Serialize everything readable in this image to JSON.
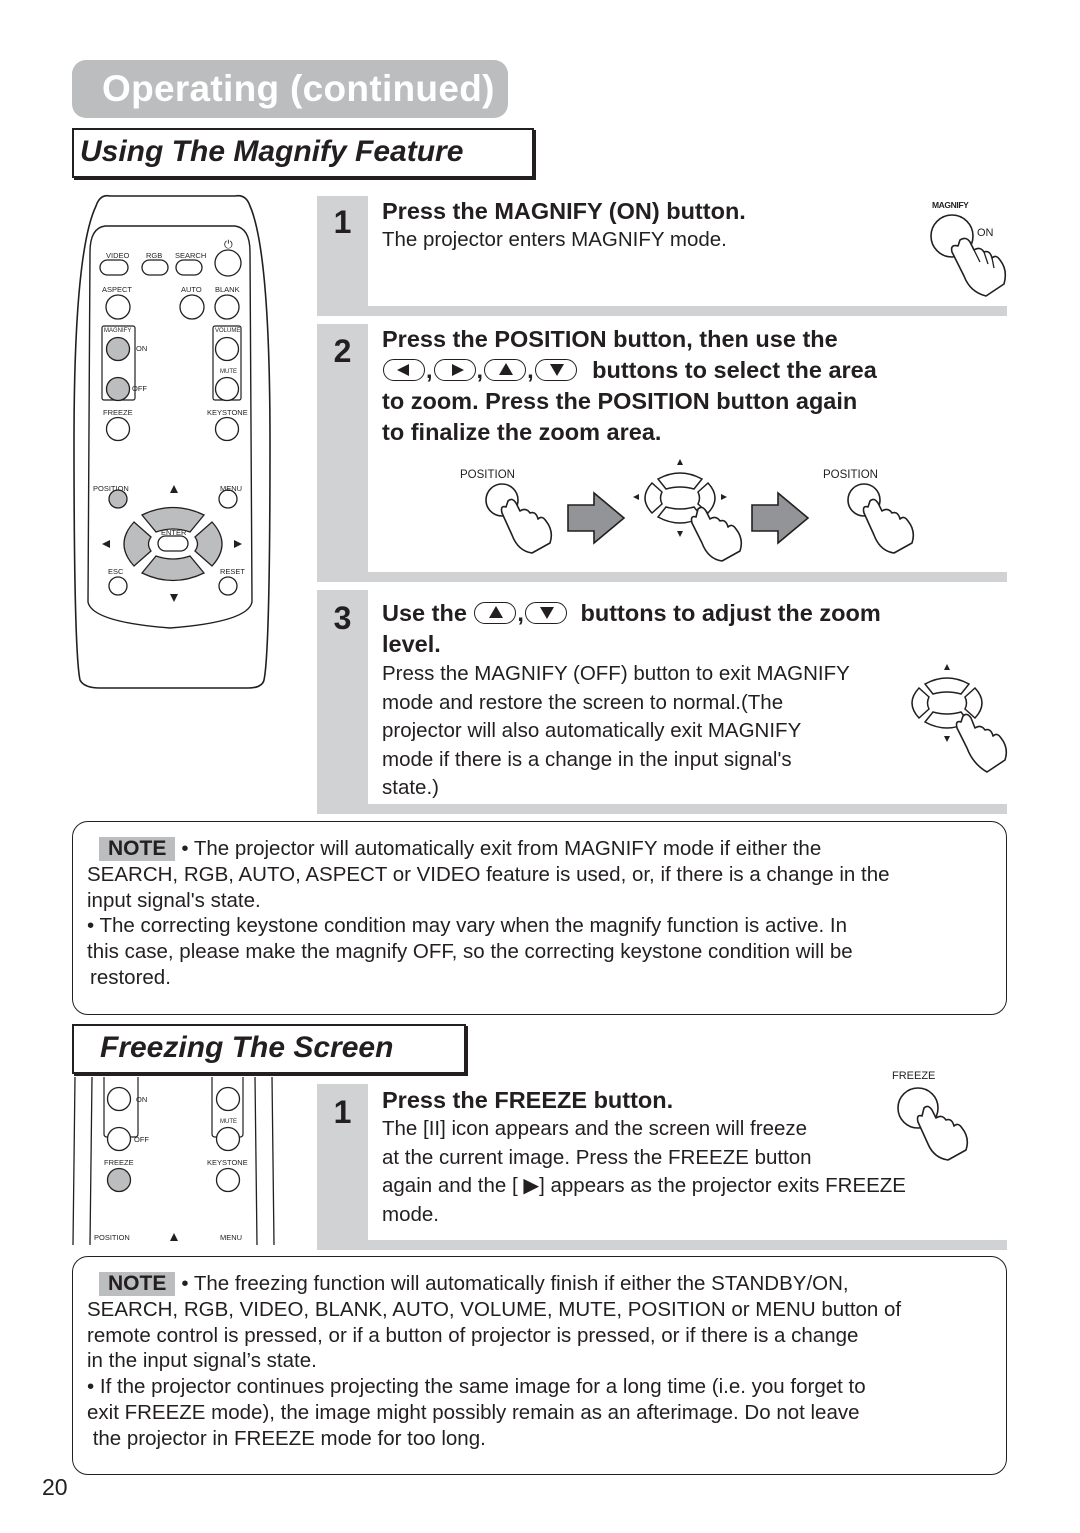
{
  "page": {
    "title": "Operating (continued)",
    "number": "20"
  },
  "magnify": {
    "heading": "Using The Magnify Feature",
    "remote": {
      "labels": {
        "video": "VIDEO",
        "rgb": "RGB",
        "search": "SEARCH",
        "aspect": "ASPECT",
        "auto": "AUTO",
        "blank": "BLANK",
        "magnify": "MAGNIFY",
        "on": "ON",
        "off": "OFF",
        "volume": "VOLUME",
        "mute": "MUTE",
        "freeze": "FREEZE",
        "keystone": "KEYSTONE",
        "position": "POSITION",
        "menu": "MENU",
        "enter": "ENTER",
        "esc": "ESC",
        "reset": "RESET"
      }
    },
    "steps": [
      {
        "number": "1",
        "heading": "Press the MAGNIFY (ON) button.",
        "body": "The projector enters MAGNIFY mode.",
        "illustration": {
          "label": "MAGNIFY",
          "sub_label": "ON",
          "icon": "hand-press-button-icon"
        }
      },
      {
        "number": "2",
        "heading_line1": "Press the POSITION button, then use the",
        "heading_buttons": [
          "left",
          "right",
          "up",
          "down"
        ],
        "heading_line2_tail": "buttons to select the area",
        "heading_line3": "to zoom. Press the POSITION button again",
        "heading_line4": "to finalize the zoom area.",
        "illustration": {
          "label_left": "POSITION",
          "label_right": "POSITION"
        }
      },
      {
        "number": "3",
        "heading_prefix": "Use the",
        "heading_buttons": [
          "up",
          "down"
        ],
        "heading_suffix": "buttons to adjust the zoom",
        "heading_line2": "level.",
        "body_lines": [
          "Press the MAGNIFY (OFF) button to exit MAGNIFY",
          "mode and restore the screen to normal.(The",
          "projector will also automatically exit MAGNIFY",
          "mode if there is a change in the input signal's",
          "state.)"
        ]
      }
    ],
    "note": {
      "tag": "NOTE",
      "lines": [
        "• The projector will automatically exit from MAGNIFY mode if either the",
        "SEARCH, RGB, AUTO, ASPECT or VIDEO feature is used, or, if there is a change in the",
        "input signal's state.",
        "• The correcting keystone condition may vary when the magnify function is active. In",
        "this case, please make the magnify OFF, so the correcting keystone condition will be",
        "restored."
      ]
    }
  },
  "freeze": {
    "heading": "Freezing The Screen",
    "remote": {
      "labels": {
        "on": "ON",
        "off": "OFF",
        "mute": "MUTE",
        "freeze": "FREEZE",
        "keystone": "KEYSTONE",
        "position": "POSITION",
        "menu": "MENU"
      }
    },
    "step": {
      "number": "1",
      "heading": "Press the FREEZE button.",
      "body_lines": [
        "The [II] icon appears and the screen will freeze",
        "at the current image. Press the FREEZE button",
        "again and the [ ▶] appears as the projector exits FREEZE",
        "mode."
      ],
      "illustration": {
        "label": "FREEZE"
      }
    },
    "note": {
      "tag": "NOTE",
      "lines": [
        "• The freezing function will automatically finish if either the STANDBY/ON,",
        "SEARCH, RGB, VIDEO, BLANK, AUTO, VOLUME, MUTE, POSITION or MENU button of",
        "remote control is pressed, or if a button of projector is pressed, or if there is a change",
        "in the input signal’s state.",
        "• If the projector continues projecting the same image for a long time (i.e. you forget to",
        "exit FREEZE mode), the image might possibly remain as an afterimage. Do not leave",
        " the projector in FREEZE mode for too long."
      ]
    }
  },
  "colors": {
    "title_bg": "#bcbdbf",
    "gutter": "#d1d2d4",
    "highlight_button": "#bcbdbf",
    "arrow_fill": "#929497",
    "ink": "#231f20"
  }
}
